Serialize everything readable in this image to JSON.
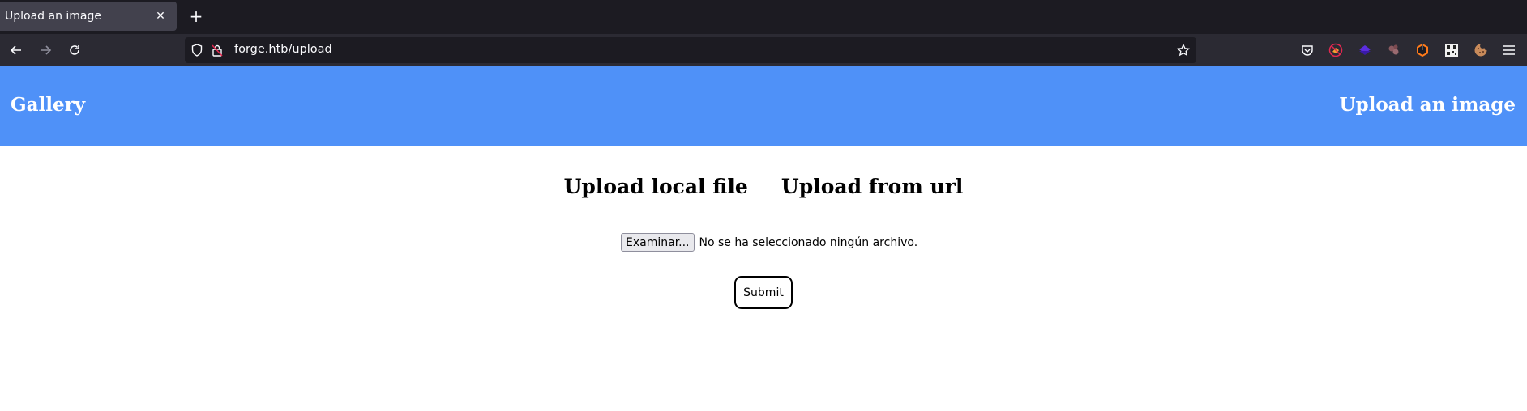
{
  "browser": {
    "tab": {
      "title": "Upload an image",
      "close_icon": "close-icon"
    },
    "new_tab_icon": "plus-icon",
    "nav": {
      "back_icon": "arrow-left-icon",
      "forward_icon": "arrow-right-icon",
      "reload_icon": "reload-icon"
    },
    "url": "forge.htb/upload",
    "url_icons": [
      "shield-icon",
      "insecure-lock-icon"
    ],
    "bookmark_icon": "star-icon",
    "toolbar_icons": [
      "pocket-icon",
      "foxyproxy-icon",
      "extension-purple-icon",
      "extension-dots-icon",
      "extension-orange-icon",
      "qr-code-icon",
      "cookie-icon",
      "menu-icon"
    ]
  },
  "page": {
    "header": {
      "background": "#4f91f8",
      "left_link": "Gallery",
      "right_link": "Upload an image"
    },
    "upload_options": [
      "Upload local file",
      "Upload from url"
    ],
    "file_input": {
      "button_label": "Examinar...",
      "status": "No se ha seleccionado ningún archivo."
    },
    "submit_label": "Submit"
  }
}
